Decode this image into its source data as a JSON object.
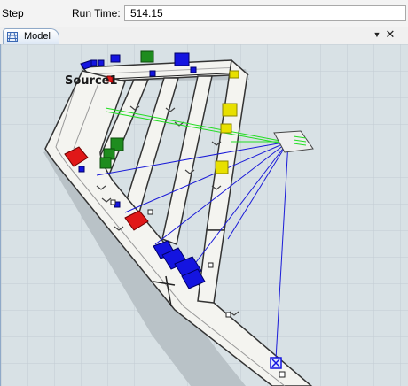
{
  "toolbar": {
    "step_label": "Step",
    "run_time_label": "Run Time:",
    "run_time_value": "514.15"
  },
  "tabs": [
    {
      "label": "Model",
      "icon": "grid-icon"
    }
  ],
  "window_controls": {
    "dropdown_icon": "chevron-down-icon",
    "close_icon": "close-icon"
  },
  "model": {
    "source_label": "Source1",
    "colors": {
      "floor": "#d8e1e5",
      "conveyor_belt": "#f4f4f0",
      "red_box": "#e01818",
      "green_box": "#1e8c1e",
      "blue_box": "#1414e0",
      "yellow_box": "#e8e000",
      "connector_green": "#22dd22",
      "connector_blue": "#1a1ad8"
    }
  }
}
